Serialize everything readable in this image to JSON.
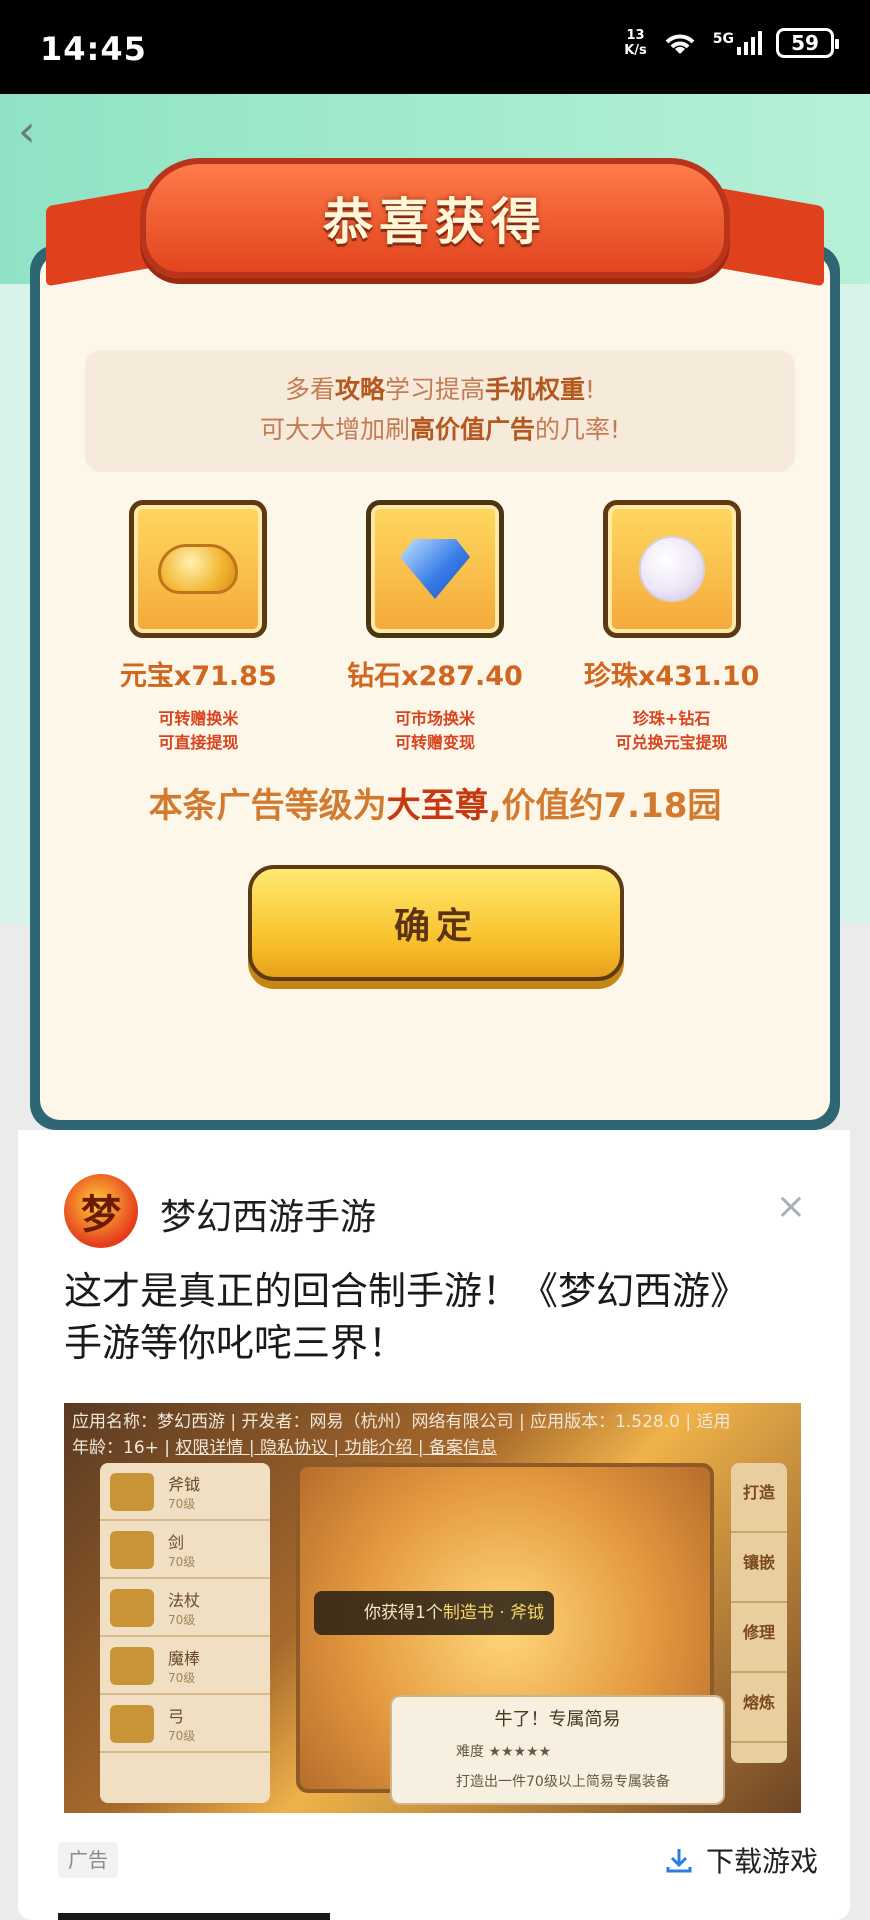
{
  "status_bar": {
    "time": "14:45",
    "net_speed_value": "13",
    "net_speed_unit": "K/s",
    "signal_label": "5G",
    "battery": "59"
  },
  "dialog": {
    "title": "恭喜获得",
    "tip_line1_a": "多看",
    "tip_line1_b": "攻略",
    "tip_line1_c": "学习提高",
    "tip_line1_d": "手机权重",
    "tip_line1_e": "!",
    "tip_line2_a": "可大大增加刷",
    "tip_line2_b": "高价值广告",
    "tip_line2_c": "的几率!",
    "rewards": [
      {
        "icon": "gold-ingot-icon",
        "amount": "元宝x71.85",
        "note1": "可转赠换米",
        "note2": "可直接提现"
      },
      {
        "icon": "diamond-icon",
        "amount": "钻石x287.40",
        "note1": "可市场换米",
        "note2": "可转赠变现"
      },
      {
        "icon": "pearl-icon",
        "amount": "珍珠x431.10",
        "note1": "珍珠+钻石",
        "note2": "可兑换元宝提现"
      }
    ],
    "level_text_a": "本条广告等级为",
    "level_text_b": "大至尊",
    "level_text_c": ",价值约7.18园",
    "confirm": "确定"
  },
  "ad": {
    "logo_char": "梦",
    "name": "梦幻西游手游",
    "close_icon": "×",
    "description": "这才是真正的回合制手游！《梦幻西游》手游等你叱咤三界！",
    "media_info_1": "应用名称：梦幻西游 | 开发者：网易（杭州）网络有限公司 | 应用版本：1.528.0 | 适用",
    "media_info_2": "年龄：16+ | ",
    "media_links": "权限详情 | 隐私协议 | 功能介绍 | 备案信息",
    "side_items": [
      {
        "name": "斧钺",
        "level": "70级"
      },
      {
        "name": "剑",
        "level": "70级"
      },
      {
        "name": "法杖",
        "level": "70级"
      },
      {
        "name": "魔棒",
        "level": "70级"
      },
      {
        "name": "弓",
        "level": "70级"
      }
    ],
    "forge_banner_a": "你获得1个",
    "forge_banner_b": "制造书 · 斧钺",
    "right_tabs": [
      "打造",
      "镶嵌",
      "修理",
      "熔炼"
    ],
    "popup_title": "牛了！专属简易",
    "popup_difficulty": "难度 ★★★★★",
    "popup_desc": "打造出一件70级以上简易专属装备",
    "tag": "广告",
    "download": "下载游戏"
  }
}
